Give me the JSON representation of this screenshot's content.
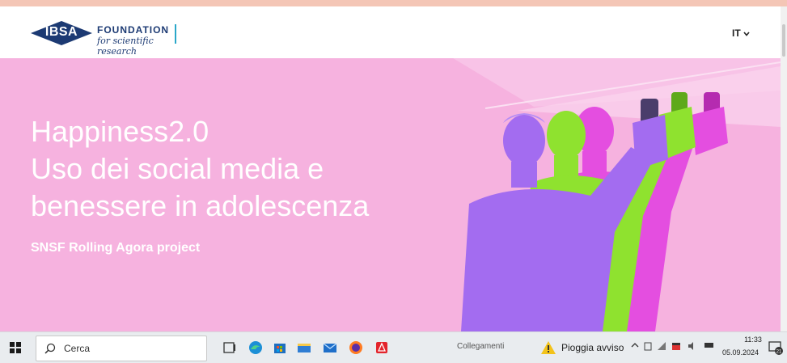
{
  "header": {
    "logo_badge": "IBSA",
    "logo_foundation": "FOUNDATION",
    "logo_tagline": "for scientific research",
    "language": "IT"
  },
  "hero": {
    "title_lines": [
      "Happiness2.0",
      "Uso dei social media e",
      "benessere in adolescenza"
    ],
    "subtitle": "SNSF Rolling Agora project",
    "background_color": "#f6b2df",
    "figure_colors": [
      "#a36cf0",
      "#8fe22f",
      "#e44ee0"
    ]
  },
  "taskbar": {
    "search_placeholder": "Cerca",
    "links_label": "Collegamenti",
    "weather": "Pioggia avviso",
    "time": "11:33",
    "date": "05.09.2024",
    "notification_count": "21"
  }
}
